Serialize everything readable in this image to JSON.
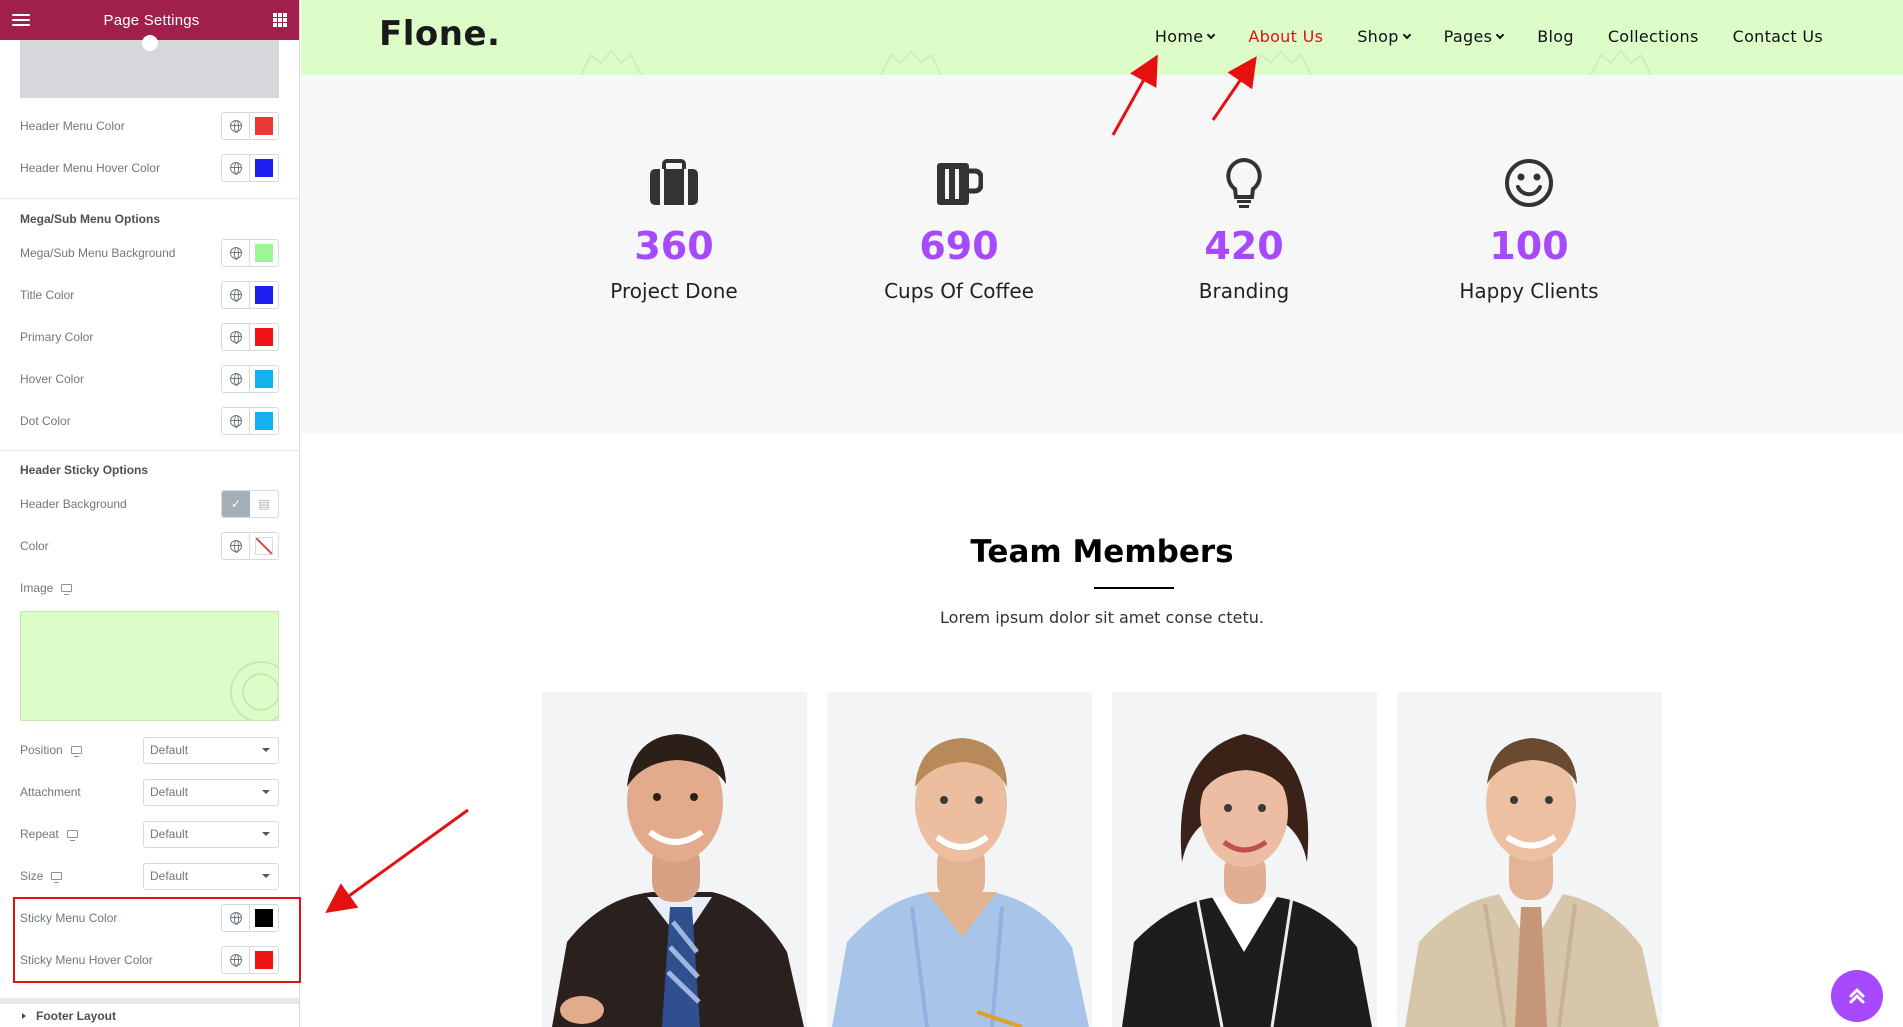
{
  "panel": {
    "title": "Page Settings",
    "rows_top": [
      {
        "label": "Header Menu Color",
        "color": "#e83838"
      },
      {
        "label": "Header Menu Hover Color",
        "color": "#1e1ef0"
      }
    ],
    "mega_section": "Mega/Sub Menu Options",
    "mega_rows": [
      {
        "label": "Mega/Sub Menu Background",
        "color": "#9ef598"
      },
      {
        "label": "Title Color",
        "color": "#1b1ff0"
      },
      {
        "label": "Primary Color",
        "color": "#f01313"
      },
      {
        "label": "Hover Color",
        "color": "#12b2f0"
      },
      {
        "label": "Dot Color",
        "color": "#12b2f0"
      }
    ],
    "sticky_section": "Header Sticky Options",
    "header_background_label": "Header Background",
    "color_label": "Color",
    "image_label": "Image",
    "selects": [
      {
        "label": "Position",
        "value": "Default"
      },
      {
        "label": "Attachment",
        "value": "Default"
      },
      {
        "label": "Repeat",
        "value": "Default"
      },
      {
        "label": "Size",
        "value": "Default"
      }
    ],
    "sticky_rows": [
      {
        "label": "Sticky Menu Color",
        "color": "#000000"
      },
      {
        "label": "Sticky Menu Hover Color",
        "color": "#f01313"
      }
    ],
    "footer_layout": "Footer Layout"
  },
  "site": {
    "logo": "Flone.",
    "nav": [
      {
        "label": "Home",
        "dropdown": true,
        "active": false
      },
      {
        "label": "About Us",
        "dropdown": false,
        "active": true
      },
      {
        "label": "Shop",
        "dropdown": true,
        "active": false
      },
      {
        "label": "Pages",
        "dropdown": true,
        "active": false
      },
      {
        "label": "Blog",
        "dropdown": false,
        "active": false
      },
      {
        "label": "Collections",
        "dropdown": false,
        "active": false
      },
      {
        "label": "Contact Us",
        "dropdown": false,
        "active": false
      }
    ],
    "stats": [
      {
        "number": "360",
        "caption": "Project Done",
        "icon": "briefcase-icon"
      },
      {
        "number": "690",
        "caption": "Cups Of Coffee",
        "icon": "coffee-mug-icon"
      },
      {
        "number": "420",
        "caption": "Branding",
        "icon": "lightbulb-icon"
      },
      {
        "number": "100",
        "caption": "Happy Clients",
        "icon": "smiley-icon"
      }
    ],
    "team_title": "Team Members",
    "team_subtitle": "Lorem ipsum dolor sit amet conse ctetu.",
    "accent": "#a749ff",
    "active_nav_color": "#e51010",
    "header_bg": "#dcfcc8"
  }
}
